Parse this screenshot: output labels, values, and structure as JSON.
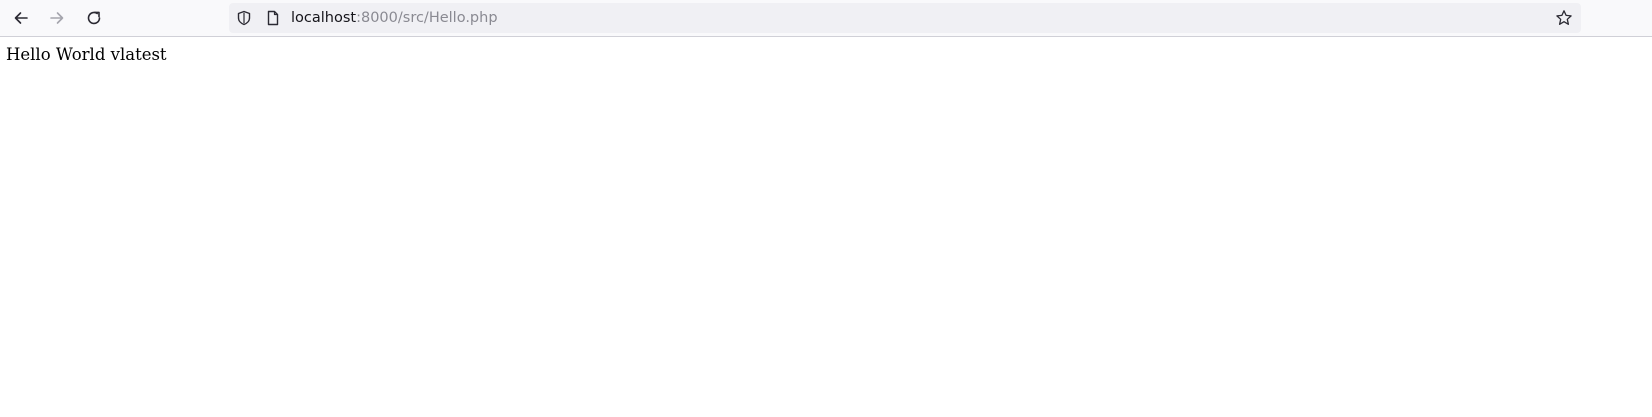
{
  "browser": {
    "url": {
      "host": "localhost",
      "rest": ":8000/src/Hello.php"
    },
    "icons": {
      "back": "arrow-left-icon",
      "forward": "arrow-right-icon",
      "reload": "reload-icon",
      "security": "shield-icon",
      "page": "page-icon",
      "bookmark": "star-icon"
    }
  },
  "page": {
    "text": "Hello World vlatest"
  }
}
